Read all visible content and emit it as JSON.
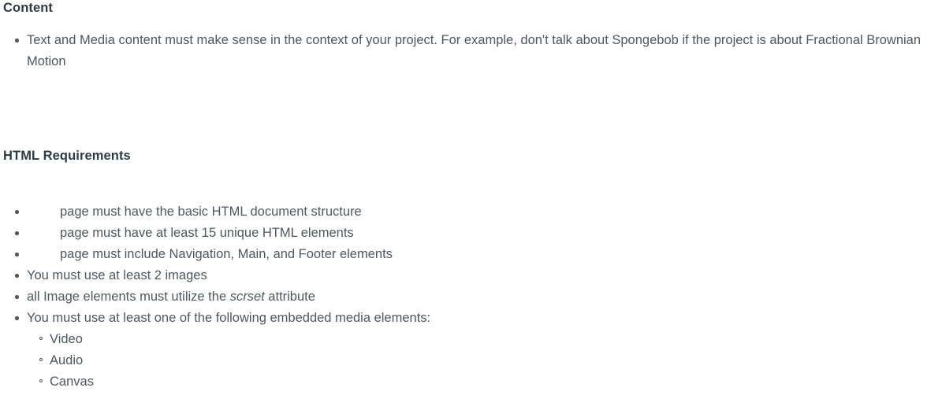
{
  "sections": [
    {
      "heading": "Content",
      "items": [
        {
          "text": "Text and Media content must make sense in the context of your project. For example, don't talk about Spongebob if the project is about Fractional Brownian Motion"
        }
      ]
    },
    {
      "heading": "HTML Requirements",
      "items": [
        {
          "text": "page must have the basic HTML document structure"
        },
        {
          "text": "page must have at least 15 unique HTML elements"
        },
        {
          "text": "page must include Navigation, Main, and Footer elements"
        },
        {
          "text": "You must use at least 2 images"
        },
        {
          "text_before": "all Image elements must utilize the ",
          "text_italic": "scrset",
          "text_after": " attribute"
        },
        {
          "text": "You must use at least one of the following embedded media elements:"
        }
      ],
      "sub_items": [
        {
          "label": "Video"
        },
        {
          "label": "Audio"
        },
        {
          "label": "Canvas"
        }
      ]
    }
  ],
  "colors": {
    "heading": "#2d3b45",
    "body_text": "#4e585d",
    "background": "#ffffff"
  }
}
